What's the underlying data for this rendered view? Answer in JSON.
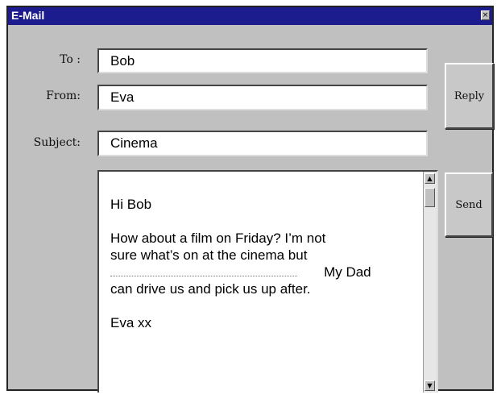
{
  "window": {
    "title": "E-Mail",
    "close_glyph": "×"
  },
  "form": {
    "to_label": "To :",
    "to_value": "Bob",
    "from_label": "From:",
    "from_value": "Eva",
    "subject_label": "Subject:",
    "subject_value": "Cinema"
  },
  "buttons": {
    "reply": "Reply",
    "send": "Send"
  },
  "message": {
    "greeting": "Hi Bob",
    "line1": "How about a film on Friday?  I’m not",
    "line2": "sure what’s on at the cinema but",
    "line3_after_blank": "My Dad",
    "line4": "can drive us and pick us up after.",
    "signoff": "Eva xx"
  },
  "scrollbar": {
    "up_glyph": "▲",
    "down_glyph": "▼"
  },
  "colors": {
    "titlebar": "#1c1c8e",
    "window_bg": "#c0c0c0"
  }
}
